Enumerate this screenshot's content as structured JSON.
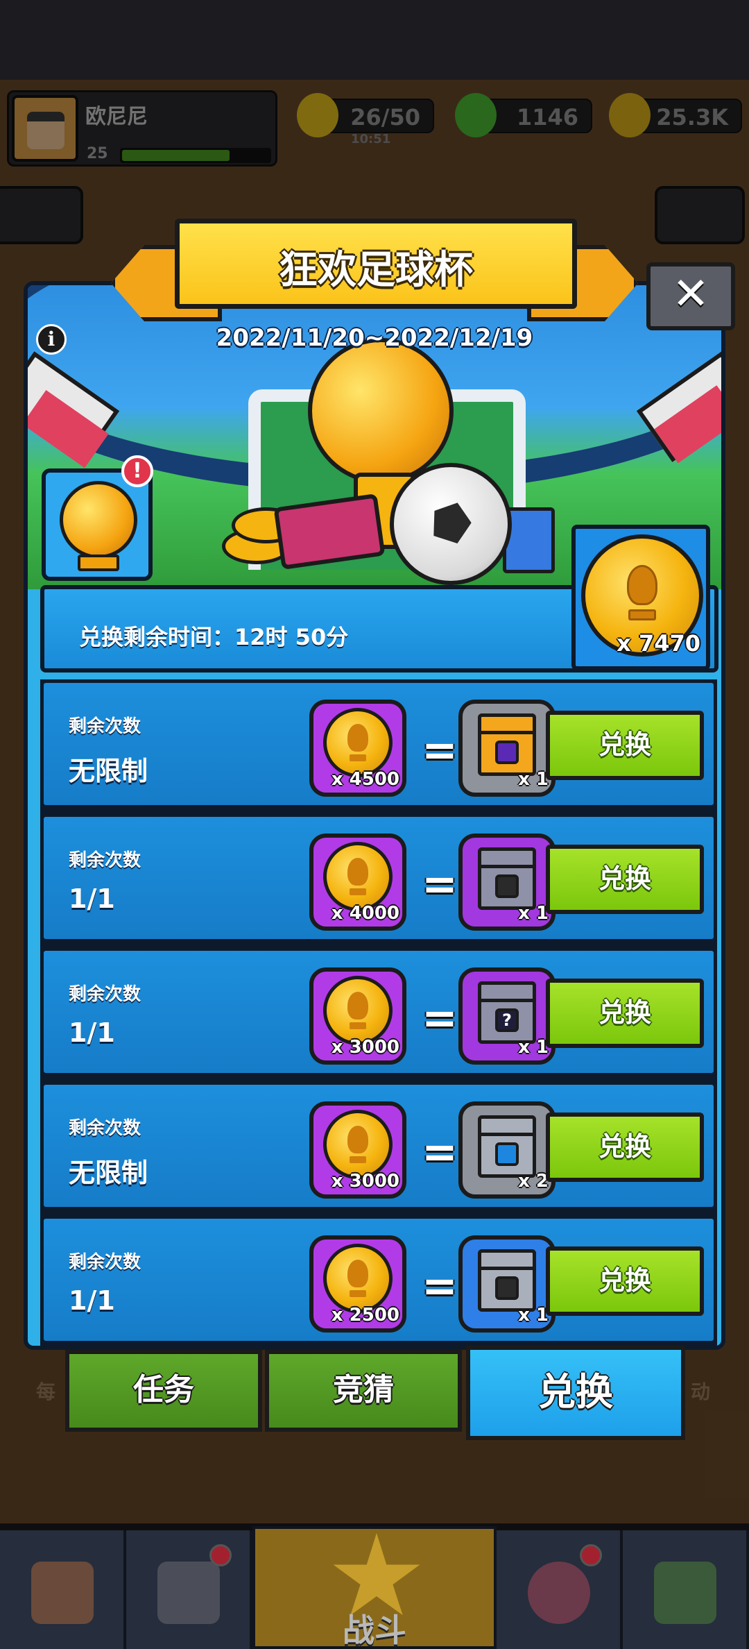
{
  "hud": {
    "player_name": "欧尼尼",
    "level": "25",
    "energy": "26/50",
    "energy_timer": "10:51",
    "gems": "1146",
    "gold": "25.3K"
  },
  "popup": {
    "title": "狂欢足球杯",
    "date_range": "2022/11/20~2022/12/19",
    "info_icon": "i",
    "alert_icon": "!",
    "close_icon": "✕",
    "timer_text": "兑换剩余时间：12时 50分",
    "token_count": "x 7470"
  },
  "exchange_rows": [
    {
      "label": "剩余次数",
      "remaining": "无限制",
      "cost": "x 4500",
      "reward_qty": "x 1",
      "reward_icon": "orange-chest-icon",
      "button": "兑换"
    },
    {
      "label": "剩余次数",
      "remaining": "1/1",
      "cost": "x 4000",
      "reward_qty": "x 1",
      "reward_icon": "purple-chest-icon",
      "button": "兑换"
    },
    {
      "label": "剩余次数",
      "remaining": "1/1",
      "cost": "x 3000",
      "reward_qty": "x 1",
      "reward_icon": "mystery-chest-icon",
      "button": "兑换"
    },
    {
      "label": "剩余次数",
      "remaining": "无限制",
      "cost": "x 3000",
      "reward_qty": "x 2",
      "reward_icon": "silver-chest-icon",
      "button": "兑换"
    },
    {
      "label": "剩余次数",
      "remaining": "1/1",
      "cost": "x 2500",
      "reward_qty": "x 1",
      "reward_icon": "blue-chest-icon",
      "button": "兑换"
    }
  ],
  "equals_sign": "=",
  "tabs": [
    {
      "label": "任务",
      "active": false
    },
    {
      "label": "竞猜",
      "active": false
    },
    {
      "label": "兑换",
      "active": true
    }
  ],
  "bottom_nav": {
    "battle_label": "战斗"
  },
  "side_labels": {
    "left": "每",
    "right": "动"
  },
  "colors": {
    "accent_blue": "#2fb0e8",
    "exchange_green": "#7bc70c",
    "title_yellow": "#fbc31a",
    "cost_purple": "#b23be8"
  }
}
